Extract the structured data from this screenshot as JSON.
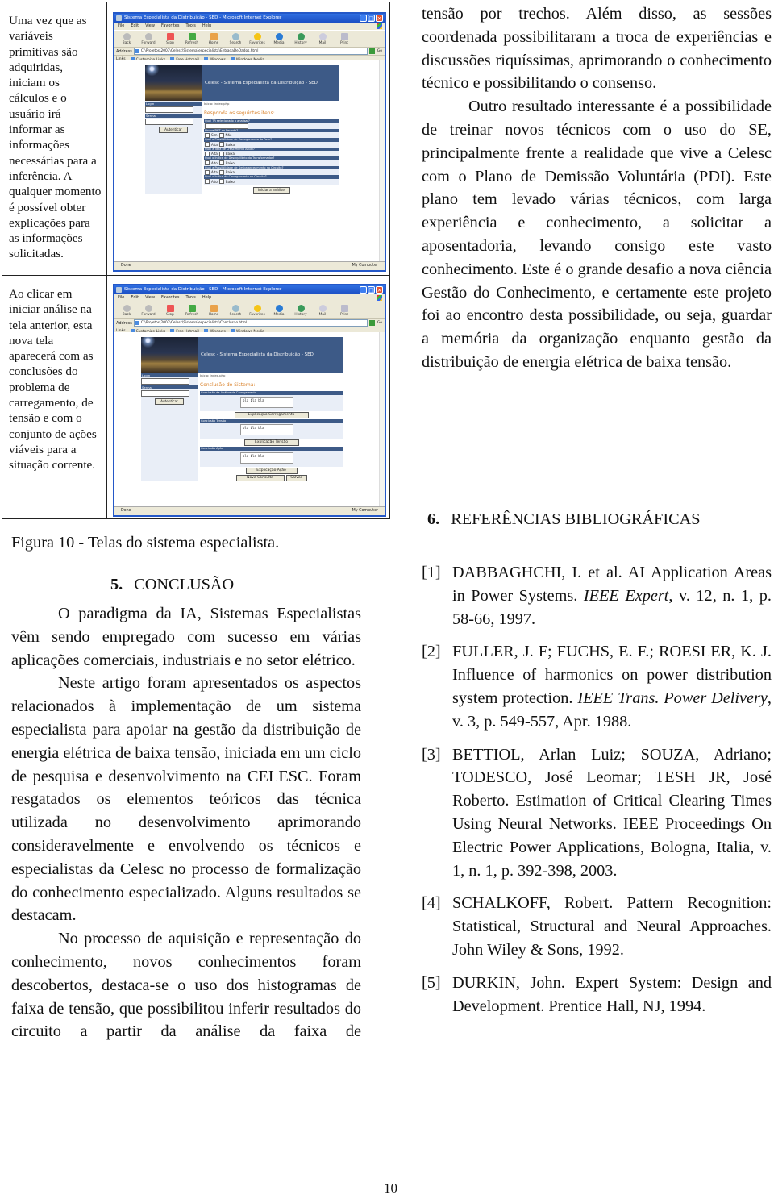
{
  "figure": {
    "rows": [
      {
        "caption": "Uma vez que as variáveis primitivas são adquiridas, iniciam os cálculos e o usuário irá informar as informações necessárias para a inferência. A qualquer momento é possível obter explicações para as informações solicitadas.",
        "browser": {
          "title": "Sistema Especialista da Distribuição - SED - Microsoft Internet Explorer",
          "menu": [
            "File",
            "Edit",
            "View",
            "Favorites",
            "Tools",
            "Help"
          ],
          "toolbar": [
            "Back",
            "Forward",
            "Stop",
            "Refresh",
            "Home",
            "Search",
            "Favorites",
            "Media",
            "History",
            "Mail",
            "Print"
          ],
          "address_label": "Address",
          "address": "C:\\Projetos\\2003\\Celesc\\Sistema\\especialista\\EntradaDeDados.html",
          "go_label": "Go",
          "links_label": "Links",
          "links": [
            "Customize Links",
            "Free Hotmail",
            "Windows",
            "Windows Media"
          ],
          "status": "Done",
          "zone": "My Computer",
          "site": {
            "banner": "Celesc - Sistema Especialista da Distribuição - SED",
            "login_label": "Login",
            "password_label": "Senha",
            "login_button": "Autenticar",
            "breadcrumb": "Inicio: index.php",
            "section_title": "Responda os seguintes itens:",
            "questions": [
              {
                "label": "Qual TR selecionado a analisar?",
                "type": "text"
              },
              {
                "label": "Houve PMT no Período?",
                "type": "choice",
                "options": [
                  "Sim",
                  "Não"
                ]
              },
              {
                "label": "Qual a Possibilidade de Carregamento da Fase?",
                "type": "choice",
                "options": [
                  "Alta",
                  "Baixa"
                ]
              },
              {
                "label": "Qual a Taxa de Crescimento Anual?",
                "type": "choice",
                "options": [
                  "Alta",
                  "Baixa"
                ]
              },
              {
                "label": "Qual o Índice de Desequilíbrio do Transformador?",
                "type": "choice",
                "options": [
                  "Alto",
                  "Baixo"
                ]
              },
              {
                "label": "Qual a Possibilidade de Desbalanceamento no Circuito?",
                "type": "choice",
                "options": [
                  "Alta",
                  "Baixa"
                ]
              },
              {
                "label": "Qual o Índice de Carregamento no Circuito?",
                "type": "choice",
                "options": [
                  "Alto",
                  "Baixo"
                ]
              }
            ],
            "submit_button": "Iniciar a análise"
          }
        }
      },
      {
        "caption": "Ao clicar em iniciar análise na tela anterior, esta nova tela aparecerá com as conclusões do problema de carregamento, de tensão e com o conjunto de ações viáveis para a situação corrente.",
        "browser": {
          "title": "Sistema Especialista da Distribuição - SED - Microsoft Internet Explorer",
          "menu": [
            "File",
            "Edit",
            "View",
            "Favorites",
            "Tools",
            "Help"
          ],
          "toolbar": [
            "Back",
            "Forward",
            "Stop",
            "Refresh",
            "Home",
            "Search",
            "Favorites",
            "Media",
            "History",
            "Mail",
            "Print"
          ],
          "address_label": "Address",
          "address": "C:\\Projetos\\2003\\Celesc\\Sistema\\especialista\\Conclusao.html",
          "go_label": "Go",
          "links_label": "Links",
          "links": [
            "Customize Links",
            "Free Hotmail",
            "Windows",
            "Windows Media"
          ],
          "status": "Done",
          "zone": "My Computer",
          "site": {
            "banner": "Celesc - Sistema Especialista da Distribuição - SED",
            "login_label": "Login",
            "password_label": "Senha",
            "login_button": "Autenticar",
            "breadcrumb": "Inicio: index.php",
            "section_title": "Conclusão do Sistema:",
            "conclusions": [
              {
                "label": "Conclusão da Análise de Carregamento",
                "text": "bla bla bla",
                "button": "Explicação Carregamento"
              },
              {
                "label": "Conclusão Tensão",
                "text": "bla bla bla",
                "button": "Explicação Tensão"
              },
              {
                "label": "Conclusão Ação",
                "text": "bla bla bla",
                "button": "Explicação Ação"
              }
            ],
            "new_query_button": "Nova Consulta",
            "save_button": "Salvar"
          }
        }
      }
    ],
    "caption": "Figura 10 - Telas do sistema especialista."
  },
  "section5": {
    "number": "5.",
    "title": "CONCLUSÃO",
    "paragraphs": [
      "O paradigma da IA, Sistemas Especialistas vêm sendo empregado com sucesso em várias aplicações comerciais, industriais e no setor elétrico.",
      "Neste artigo foram apresentados os aspectos relacionados à implementação de um sistema especialista para apoiar na gestão da distribuição de energia elétrica de baixa tensão, iniciada em um ciclo de pesquisa e desenvolvimento na CELESC. Foram resgatados os elementos teóricos das técnica utilizada no desenvolvimento aprimorando consideravelmente e envolvendo os técnicos e especialistas da Celesc no processo de formalização do conhecimento especializado. Alguns resultados se destacam.",
      "No processo de aquisição e representação do conhecimento, novos conhecimentos foram descobertos, destaca-se o uso dos histogramas de faixa de tensão, que possibilitou inferir resultados do circuito a partir da análise da faixa de"
    ]
  },
  "right_column": {
    "paragraphs": [
      "tensão por trechos. Além disso, as sessões coordenada possibilitaram a troca de experiências e discussões riquíssimas, aprimorando o conhecimento técnico e possibilitando o consenso.",
      "Outro resultado interessante é a possibilidade de treinar novos técnicos com o uso do SE, principalmente frente a realidade que vive a Celesc com o Plano de Demissão Voluntária (PDI). Este plano tem levado várias técnicos, com larga experiência e conhecimento, a solicitar a aposentadoria, levando consigo este vasto conhecimento. Este é o grande desafio a nova ciência Gestão do Conhecimento, e certamente este projeto foi ao encontro desta possibilidade, ou seja, guardar a memória da organização enquanto gestão da distribuição de energia elétrica de baixa tensão."
    ]
  },
  "section6": {
    "number": "6.",
    "title": "REFERÊNCIAS BIBLIOGRÁFICAS",
    "references": [
      {
        "num": "[1]",
        "pre": "DABBAGHCHI, I. et al. AI Application Areas in Power Systems. ",
        "italic": "IEEE Expert",
        "post": ", v. 12, n. 1, p. 58-66, 1997."
      },
      {
        "num": "[2]",
        "pre": "FULLER, J. F; FUCHS, E. F.; ROESLER, K. J. Influence of harmonics on power distribution system protection. ",
        "italic": "IEEE Trans. Power Delivery",
        "post": ", v. 3, p. 549-557, Apr. 1988."
      },
      {
        "num": "[3]",
        "pre": "BETTIOL, Arlan Luiz; SOUZA, Adriano; TODESCO, José Leomar; TESH JR, José Roberto. Estimation of Critical Clearing Times Using Neural Networks. IEEE Proceedings On Electric Power Applications, Bologna, Italia, v. 1, n. 1, p. 392-398, 2003.",
        "italic": "",
        "post": ""
      },
      {
        "num": "[4]",
        "pre": "SCHALKOFF, Robert. Pattern Recognition: Statistical, Structural and Neural Approaches. John Wiley & Sons, 1992.",
        "italic": "",
        "post": ""
      },
      {
        "num": "[5]",
        "pre": "DURKIN, John. Expert System: Design and Development. Prentice Hall, NJ, 1994.",
        "italic": "",
        "post": ""
      }
    ]
  },
  "page_number": "10"
}
